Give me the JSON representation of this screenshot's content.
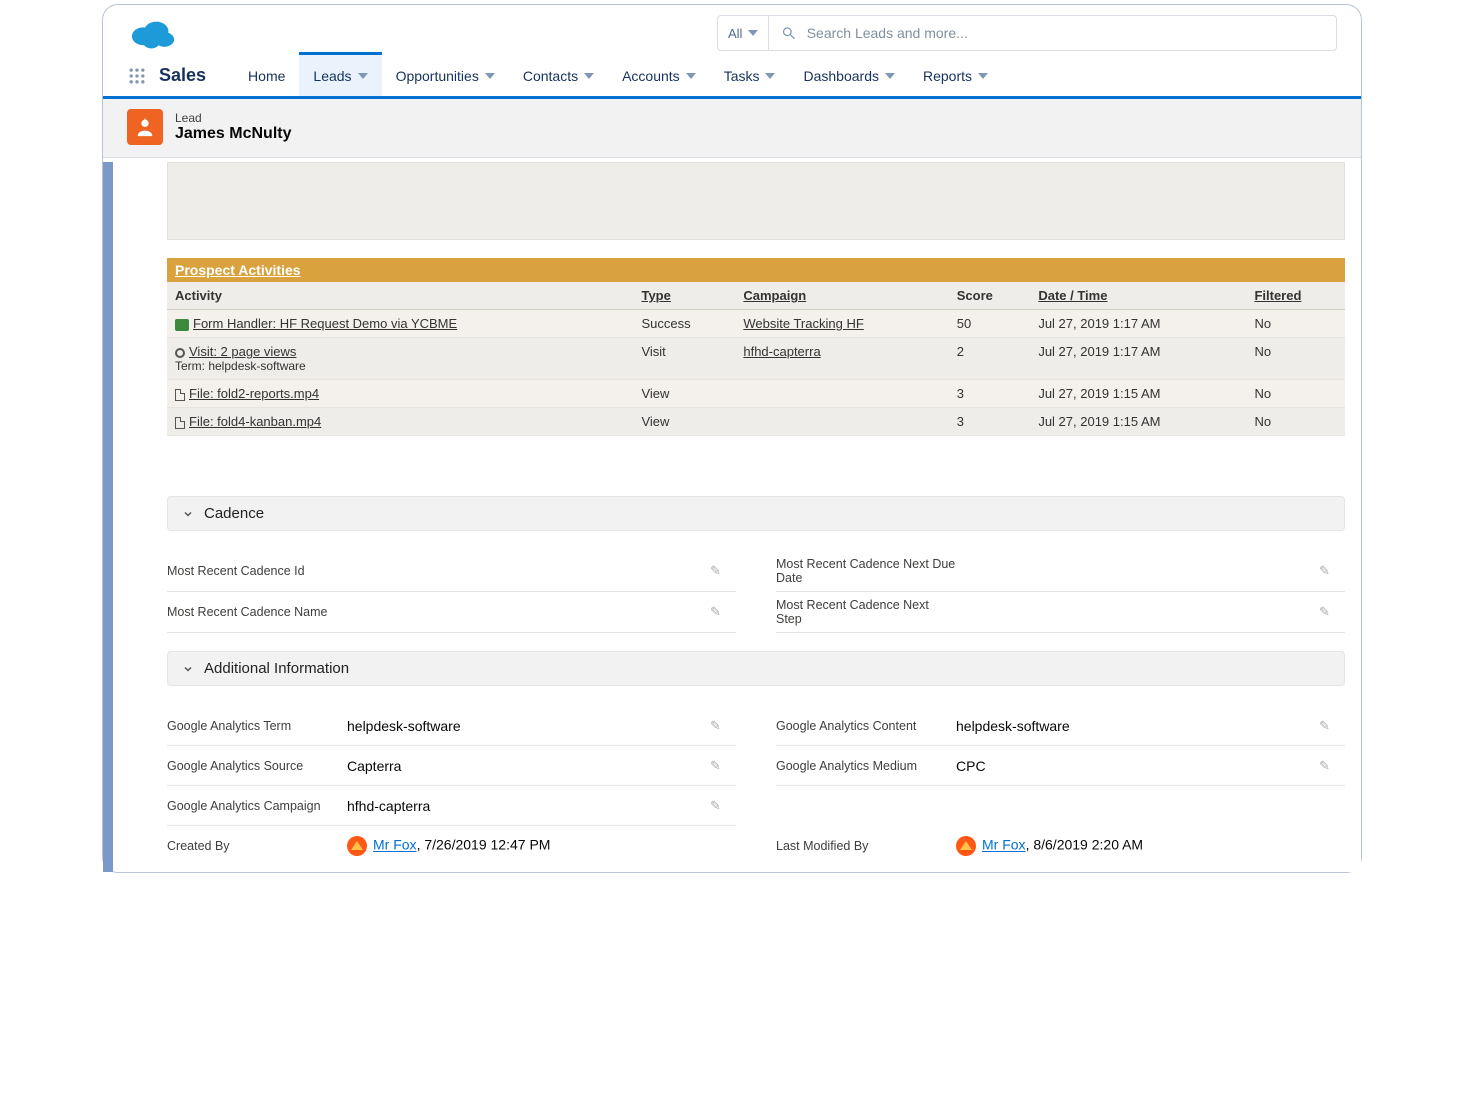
{
  "search": {
    "scope": "All",
    "placeholder": "Search Leads and more..."
  },
  "appName": "Sales",
  "nav": {
    "items": [
      {
        "label": "Home"
      },
      {
        "label": "Leads"
      },
      {
        "label": "Opportunities"
      },
      {
        "label": "Contacts"
      },
      {
        "label": "Accounts"
      },
      {
        "label": "Tasks"
      },
      {
        "label": "Dashboards"
      },
      {
        "label": "Reports"
      }
    ],
    "activeIndex": 1
  },
  "record": {
    "type": "Lead",
    "name": "James McNulty"
  },
  "prospectActivities": {
    "title": "Prospect Activities",
    "columns": [
      "Activity",
      "Type",
      "Campaign",
      "Score",
      "Date / Time",
      "Filtered"
    ],
    "rows": [
      {
        "icon": "form",
        "activity": "Form Handler: HF Request Demo via YCBME",
        "sub": "",
        "type": "Success",
        "campaign": "Website Tracking HF",
        "score": "50",
        "datetime": "Jul 27, 2019 1:17 AM",
        "filtered": "No"
      },
      {
        "icon": "visit",
        "activity": "Visit: 2 page views",
        "sub": "Term: helpdesk-software",
        "type": "Visit",
        "campaign": "hfhd-capterra",
        "score": "2",
        "datetime": "Jul 27, 2019 1:17 AM",
        "filtered": "No"
      },
      {
        "icon": "file",
        "activity": "File: fold2-reports.mp4",
        "sub": "",
        "type": "View",
        "campaign": "",
        "score": "3",
        "datetime": "Jul 27, 2019 1:15 AM",
        "filtered": "No"
      },
      {
        "icon": "file",
        "activity": "File: fold4-kanban.mp4",
        "sub": "",
        "type": "View",
        "campaign": "",
        "score": "3",
        "datetime": "Jul 27, 2019 1:15 AM",
        "filtered": "No"
      }
    ]
  },
  "sections": {
    "cadence": {
      "title": "Cadence",
      "fields": {
        "most_recent_cadence_id_label": "Most Recent Cadence Id",
        "most_recent_cadence_id_value": "",
        "most_recent_cadence_next_due_label": "Most Recent Cadence Next Due Date",
        "most_recent_cadence_next_due_value": "",
        "most_recent_cadence_name_label": "Most Recent Cadence Name",
        "most_recent_cadence_name_value": "",
        "most_recent_cadence_next_step_label": "Most Recent Cadence Next Step",
        "most_recent_cadence_next_step_value": ""
      }
    },
    "additional": {
      "title": "Additional Information",
      "fields": {
        "ga_term_label": "Google Analytics Term",
        "ga_term_value": "helpdesk-software",
        "ga_content_label": "Google Analytics Content",
        "ga_content_value": "helpdesk-software",
        "ga_source_label": "Google Analytics Source",
        "ga_source_value": "Capterra",
        "ga_medium_label": "Google Analytics Medium",
        "ga_medium_value": "CPC",
        "ga_campaign_label": "Google Analytics Campaign",
        "ga_campaign_value": "hfhd-capterra",
        "created_by_label": "Created By",
        "created_by_user": "Mr Fox",
        "created_by_date": ", 7/26/2019 12:47 PM",
        "last_modified_by_label": "Last Modified By",
        "last_modified_by_user": "Mr Fox",
        "last_modified_by_date": ", 8/6/2019 2:20 AM"
      }
    }
  }
}
